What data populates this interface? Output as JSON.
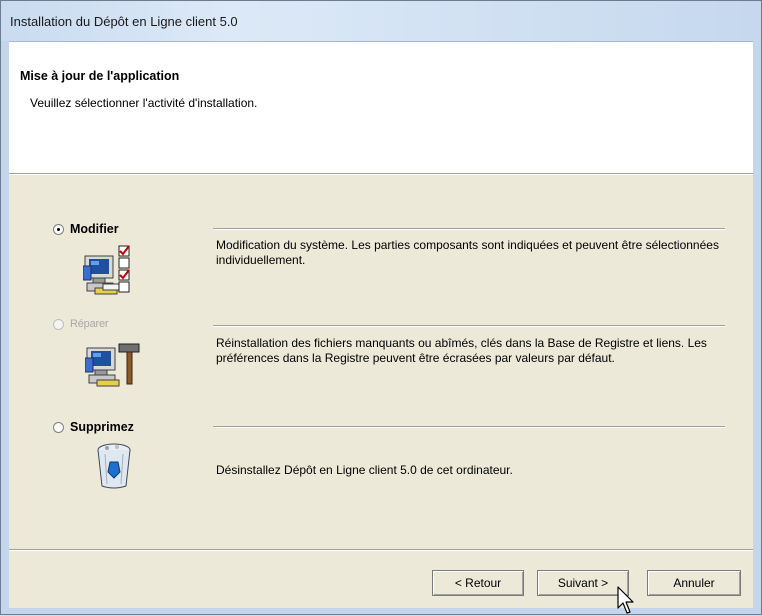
{
  "window": {
    "title": "Installation du Dépôt en Ligne client 5.0"
  },
  "banner": {
    "title": "Mise à jour de l'application",
    "subtitle": "Veuillez sélectionner l'activité d'installation."
  },
  "options": [
    {
      "label": "Modifier",
      "selected": true,
      "enabled": true,
      "icon": "modify-computer-checklist-icon",
      "description": "Modification du système. Les parties composants sont indiquées et peuvent être sélectionnées individuellement."
    },
    {
      "label": "Réparer",
      "selected": false,
      "enabled": false,
      "icon": "repair-computer-hammer-icon",
      "description": "Réinstallation des fichiers manquants ou abîmés, clés dans la Base de Registre et liens. Les préférences dans la Registre peuvent être écrasées par valeurs par défaut."
    },
    {
      "label": "Supprimez",
      "selected": false,
      "enabled": true,
      "icon": "recycle-bin-icon",
      "description": "Désinstallez Dépôt en Ligne client 5.0 de cet ordinateur."
    }
  ],
  "buttons": {
    "back": "< Retour",
    "next": "Suivant >",
    "cancel": "Annuler"
  }
}
